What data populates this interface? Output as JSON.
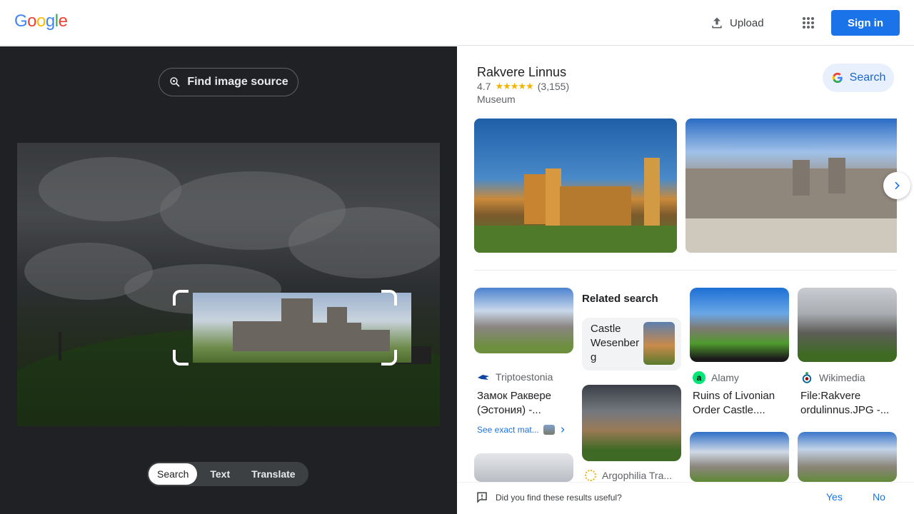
{
  "header": {
    "logo_letters": [
      {
        "ch": "G",
        "color": "#4285F4"
      },
      {
        "ch": "o",
        "color": "#EA4335"
      },
      {
        "ch": "o",
        "color": "#FBBC05"
      },
      {
        "ch": "g",
        "color": "#4285F4"
      },
      {
        "ch": "l",
        "color": "#34A853"
      },
      {
        "ch": "e",
        "color": "#EA4335"
      }
    ],
    "upload_label": "Upload",
    "signin_label": "Sign in"
  },
  "left": {
    "find_source_label": "Find image source",
    "tabs": [
      "Search",
      "Text",
      "Translate"
    ],
    "active_tab": "Search"
  },
  "knowledge_panel": {
    "title": "Rakvere Linnus",
    "rating": "4.7",
    "stars": "★★★★★",
    "reviews": "(3,155)",
    "type": "Museum",
    "search_label": "Search"
  },
  "results": {
    "col1": {
      "source": "Triptoestonia",
      "title": "Замок Раквере (Эстония) -...",
      "see_exact": "See exact mat..."
    },
    "related": {
      "heading": "Related search",
      "chip_label": "Castle Wesenber g",
      "second_source": "Argophilia Tra..."
    },
    "col3": {
      "source": "Alamy",
      "source_icon": "a",
      "title": "Ruins of Livonian Order Castle...."
    },
    "col4": {
      "source": "Wikimedia",
      "title": "File:Rakvere ordulinnus.JPG -..."
    }
  },
  "feedback": {
    "question": "Did you find these results useful?",
    "yes": "Yes",
    "no": "No"
  },
  "colors": {
    "primary_blue": "#1a73e8",
    "dark_bg": "#202124",
    "star_yellow": "#f5b400"
  }
}
